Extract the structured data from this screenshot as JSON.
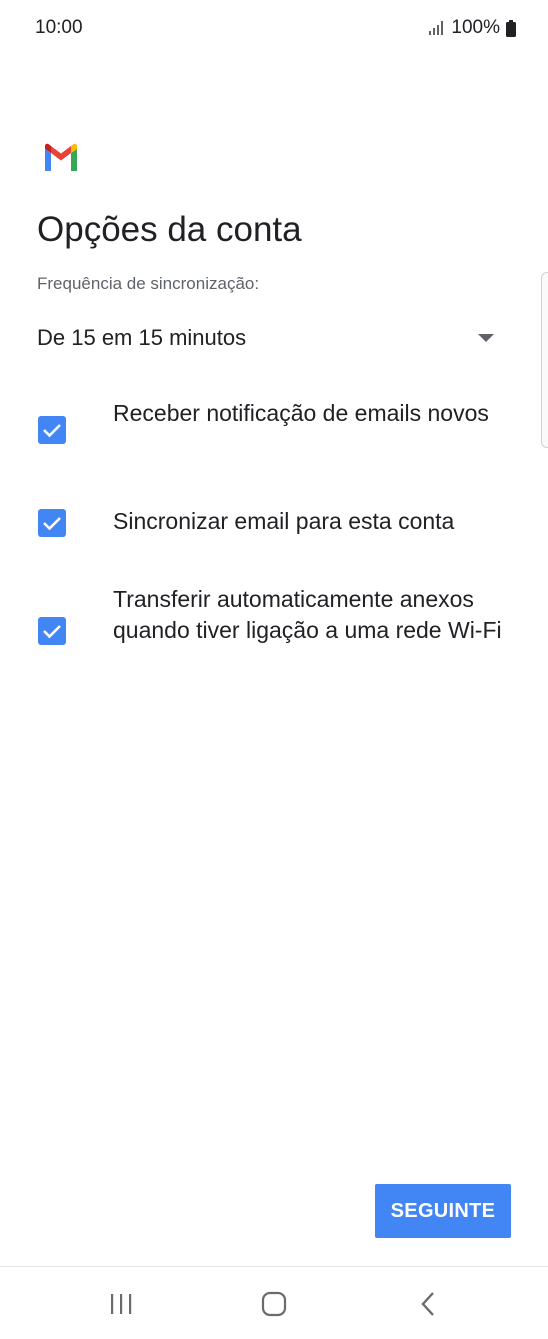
{
  "status_bar": {
    "time": "10:00",
    "battery": "100%",
    "icons": [
      "signal-icon",
      "battery-icon"
    ]
  },
  "app": {
    "logo": "gmail-logo"
  },
  "page": {
    "title": "Opções da conta"
  },
  "sync": {
    "label": "Frequência de sincronização:",
    "selected": "De 15 em 15 minutos"
  },
  "options": [
    {
      "label": "Receber notificação de emails novos",
      "checked": true
    },
    {
      "label": "Sincronizar email para esta conta",
      "checked": true
    },
    {
      "label": "Transferir automaticamente anexos quando tiver ligação a uma rede Wi-Fi",
      "checked": true
    }
  ],
  "actions": {
    "next_label": "SEGUINTE"
  },
  "nav_bar": {
    "icons": [
      "recent-apps-icon",
      "home-icon",
      "back-icon"
    ]
  },
  "colors": {
    "accent": "#4285f4",
    "text": "#202124",
    "secondary_text": "#5f6368",
    "background": "#ffffff"
  }
}
